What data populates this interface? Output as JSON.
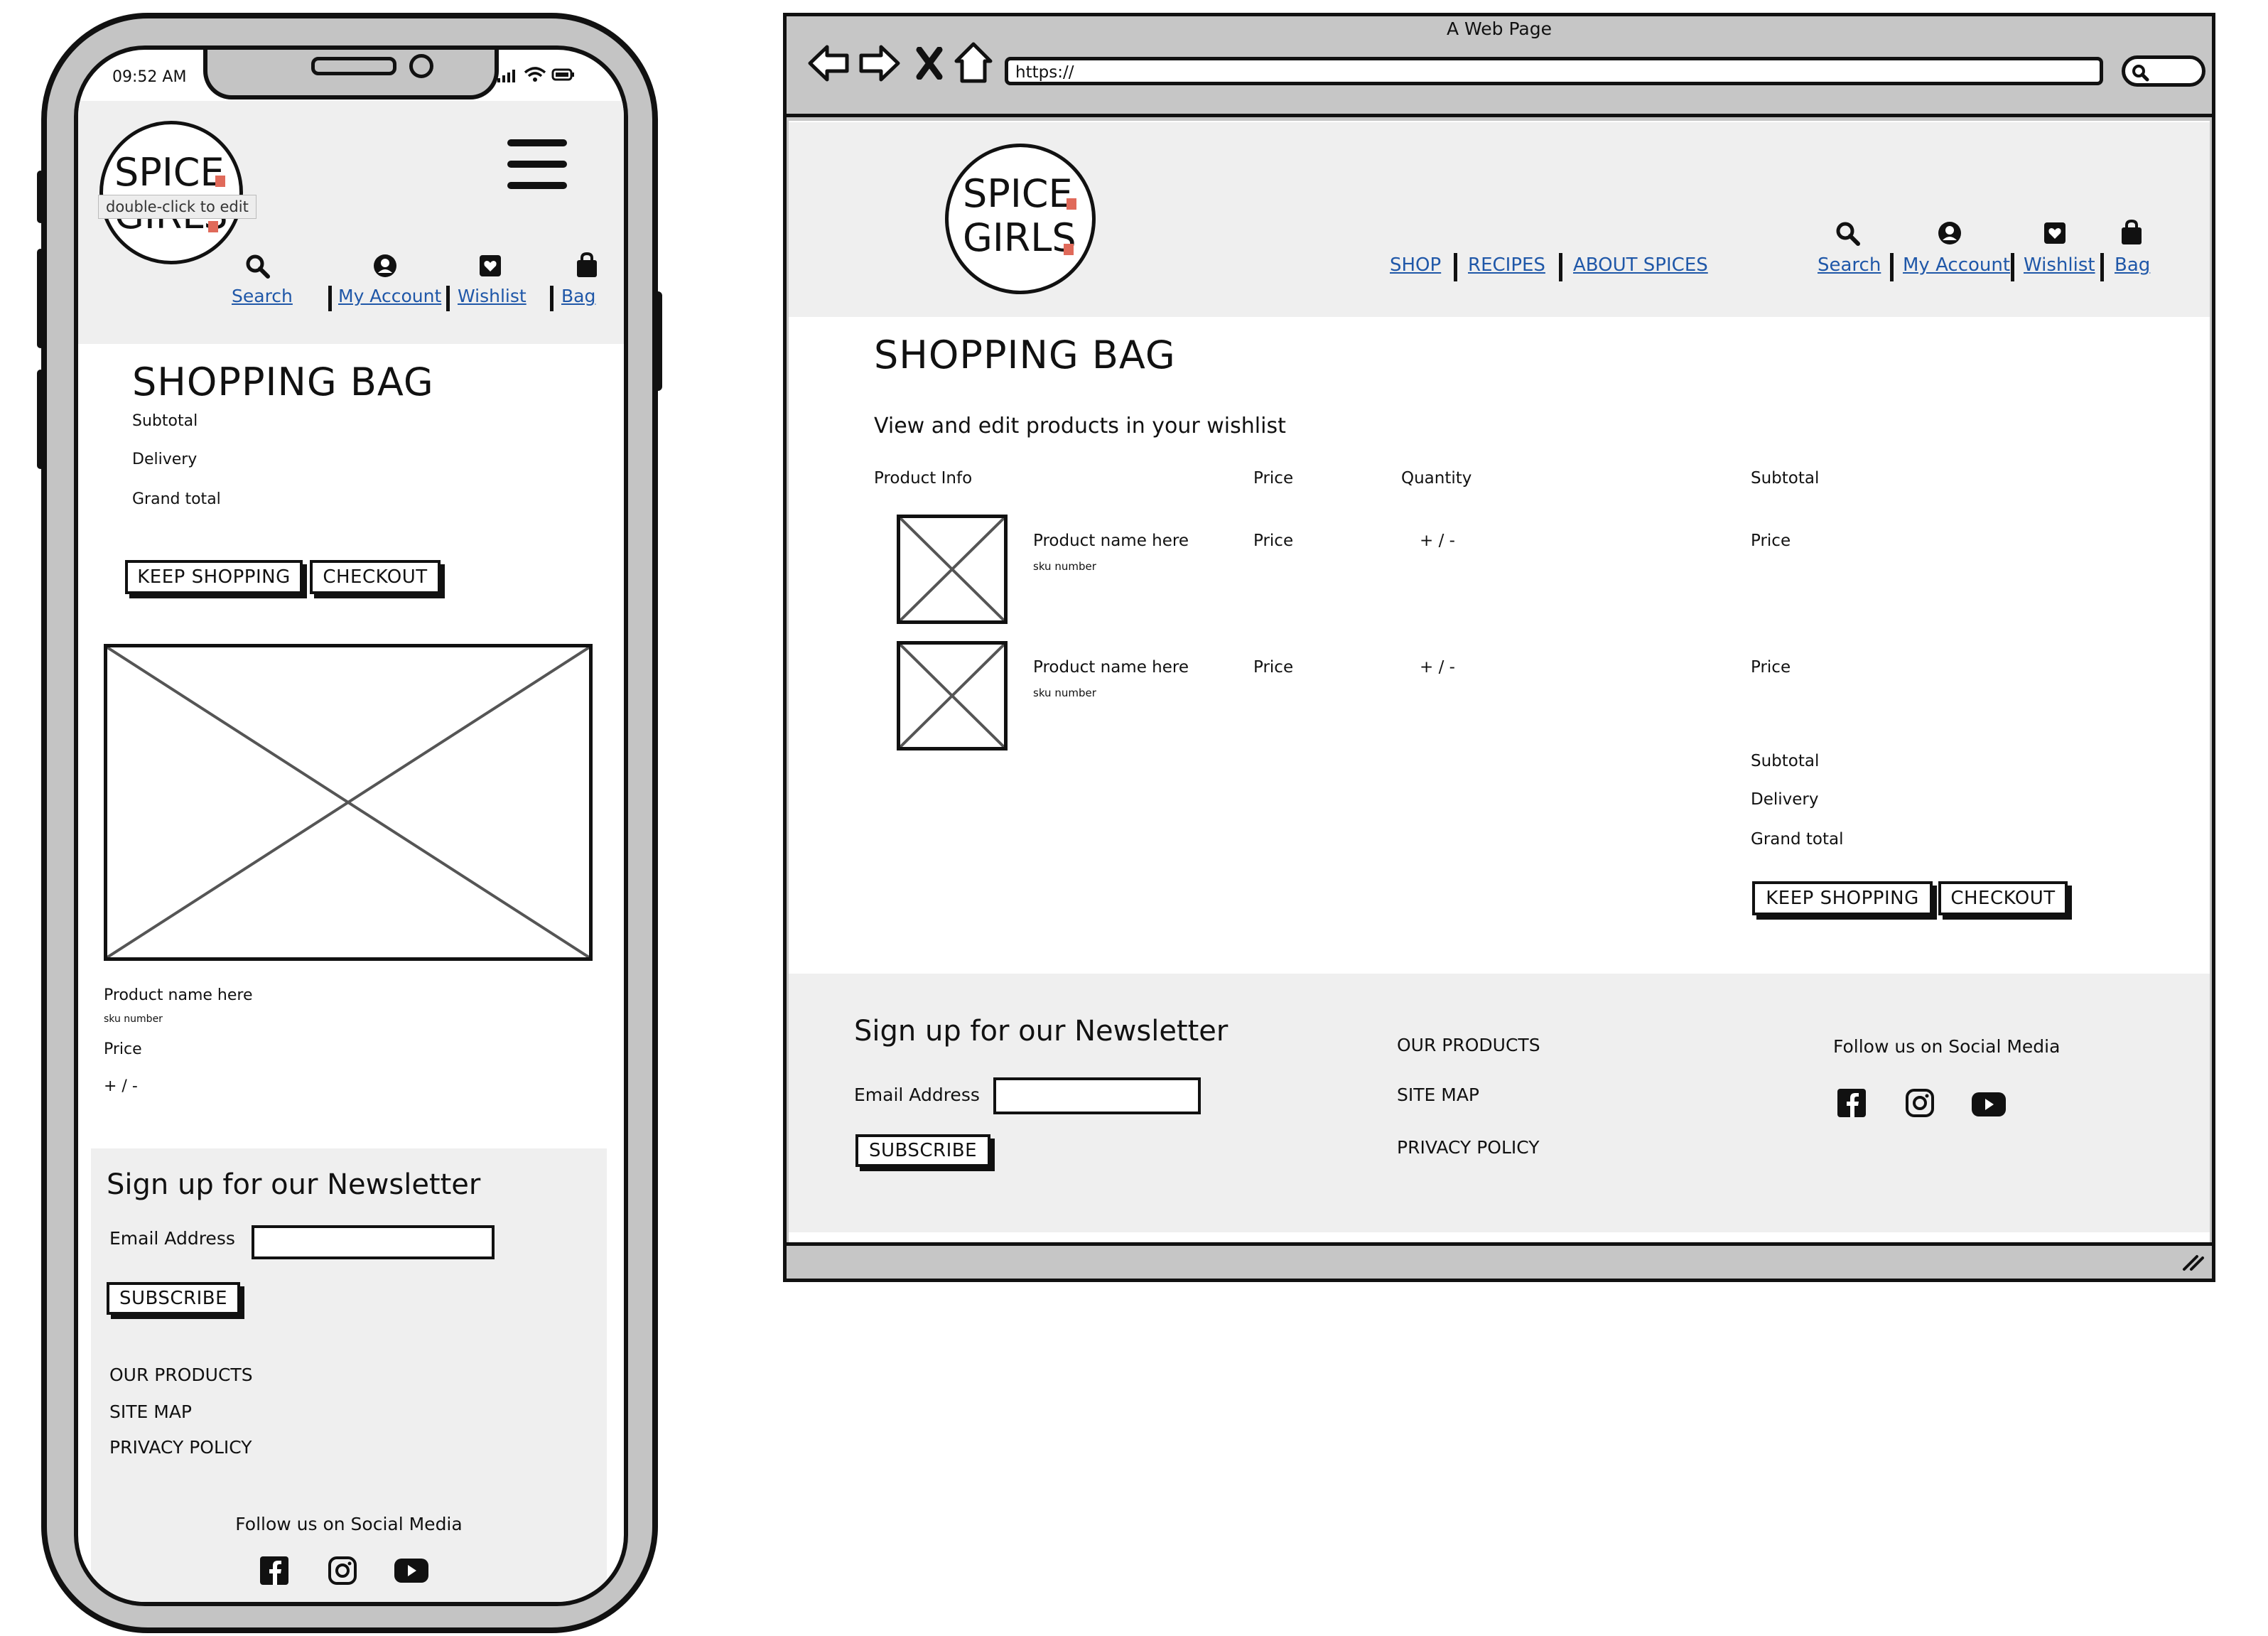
{
  "phone": {
    "status_time": "09:52 AM",
    "logo_line1": "SPICE",
    "logo_line2": "GIRLS",
    "edit_tooltip": "double-click to edit",
    "nav": [
      {
        "label": "Search",
        "icon": "search-icon"
      },
      {
        "label": "My Account",
        "icon": "user-icon"
      },
      {
        "label": "Wishlist",
        "icon": "heart-icon"
      },
      {
        "label": "Bag",
        "icon": "bag-icon"
      }
    ],
    "page_title": "SHOPPING BAG",
    "totals": [
      "Subtotal",
      "Delivery",
      "Grand total"
    ],
    "keep_shopping_label": "KEEP SHOPPING",
    "checkout_label": "CHECKOUT",
    "product": {
      "name": "Product name here",
      "sku": "sku number",
      "price": "Price",
      "quantity": "+ / -"
    },
    "newsletter_title": "Sign up for our Newsletter",
    "email_label": "Email Address",
    "subscribe_label": "SUBSCRIBE",
    "footer_links": [
      "OUR PRODUCTS",
      "SITE MAP",
      "PRIVACY POLICY"
    ],
    "social_title": "Follow us on Social Media",
    "social_icons": [
      "facebook-icon",
      "instagram-icon",
      "youtube-icon"
    ]
  },
  "browser": {
    "window_title": "A Web Page",
    "url": "https://",
    "logo_line1": "SPICE",
    "logo_line2": "GIRLS",
    "main_nav": [
      "SHOP",
      "RECIPES",
      "ABOUT SPICES"
    ],
    "nav": [
      {
        "label": "Search",
        "icon": "search-icon"
      },
      {
        "label": "My Account",
        "icon": "user-icon"
      },
      {
        "label": "Wishlist",
        "icon": "heart-icon"
      },
      {
        "label": "Bag",
        "icon": "bag-icon"
      }
    ],
    "page_title": "SHOPPING BAG",
    "subtitle": "View and edit products in your wishlist",
    "table_headers": [
      "Product Info",
      "Price",
      "Quantity",
      "Subtotal"
    ],
    "rows": [
      {
        "name": "Product name here",
        "sku": "sku number",
        "price": "Price",
        "quantity": "+ / -",
        "subtotal": "Price"
      },
      {
        "name": "Product name here",
        "sku": "sku number",
        "price": "Price",
        "quantity": "+ / -",
        "subtotal": "Price"
      }
    ],
    "totals": [
      "Subtotal",
      "Delivery",
      "Grand total"
    ],
    "keep_shopping_label": "KEEP SHOPPING",
    "checkout_label": "CHECKOUT",
    "newsletter_title": "Sign up for our Newsletter",
    "email_label": "Email Address",
    "subscribe_label": "SUBSCRIBE",
    "footer_links": [
      "OUR PRODUCTS",
      "SITE MAP",
      "PRIVACY POLICY"
    ],
    "social_title": "Follow us on Social Media",
    "social_icons": [
      "facebook-icon",
      "instagram-icon",
      "youtube-icon"
    ]
  },
  "colors": {
    "link": "#1f57a8",
    "header_bg": "#efefef",
    "frame_gray": "#c4c4c4",
    "logo_accent": "#e06a5a"
  }
}
